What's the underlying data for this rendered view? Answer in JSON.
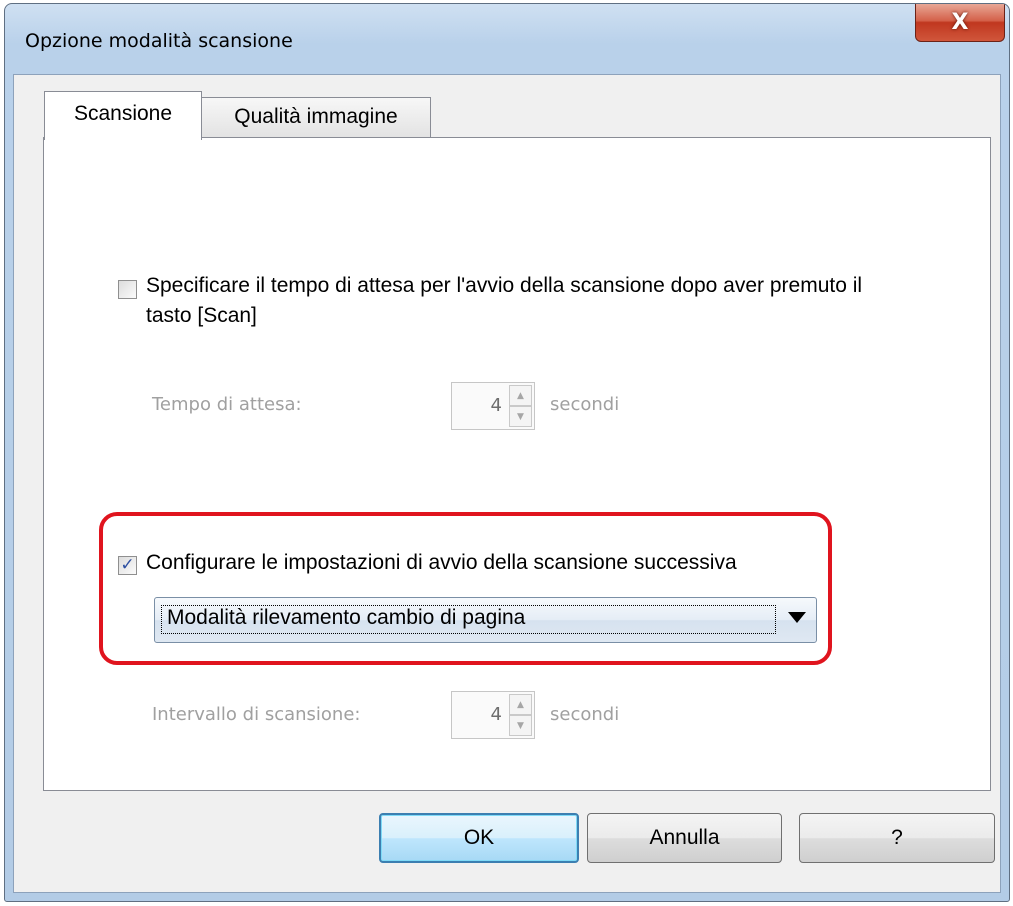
{
  "window": {
    "title": "Opzione modalità scansione",
    "close_glyph": "X",
    "close_icon": "close-icon"
  },
  "tabs": [
    {
      "label": "Scansione",
      "active": true
    },
    {
      "label": "Qualità immagine",
      "active": false
    }
  ],
  "scan_tab": {
    "wait_option": {
      "checked": false,
      "label": "Specificare il tempo di attesa per l'avvio della scansione dopo aver premuto il tasto [Scan]",
      "field_label": "Tempo di attesa:",
      "value": "4",
      "unit": "secondi",
      "enabled": false
    },
    "next_scan_option": {
      "checked": true,
      "check_glyph": "✓",
      "label": "Configurare le impostazioni di avvio della scansione successiva",
      "mode_selected": "Modalità rilevamento cambio di pagina"
    },
    "interval": {
      "field_label": "Intervallo di scansione:",
      "value": "4",
      "unit": "secondi",
      "enabled": false
    }
  },
  "spin_glyphs": {
    "up": "▲",
    "down": "▼"
  },
  "highlight_color": "#e0141e",
  "buttons": {
    "ok": "OK",
    "cancel": "Annulla",
    "help": "?"
  }
}
